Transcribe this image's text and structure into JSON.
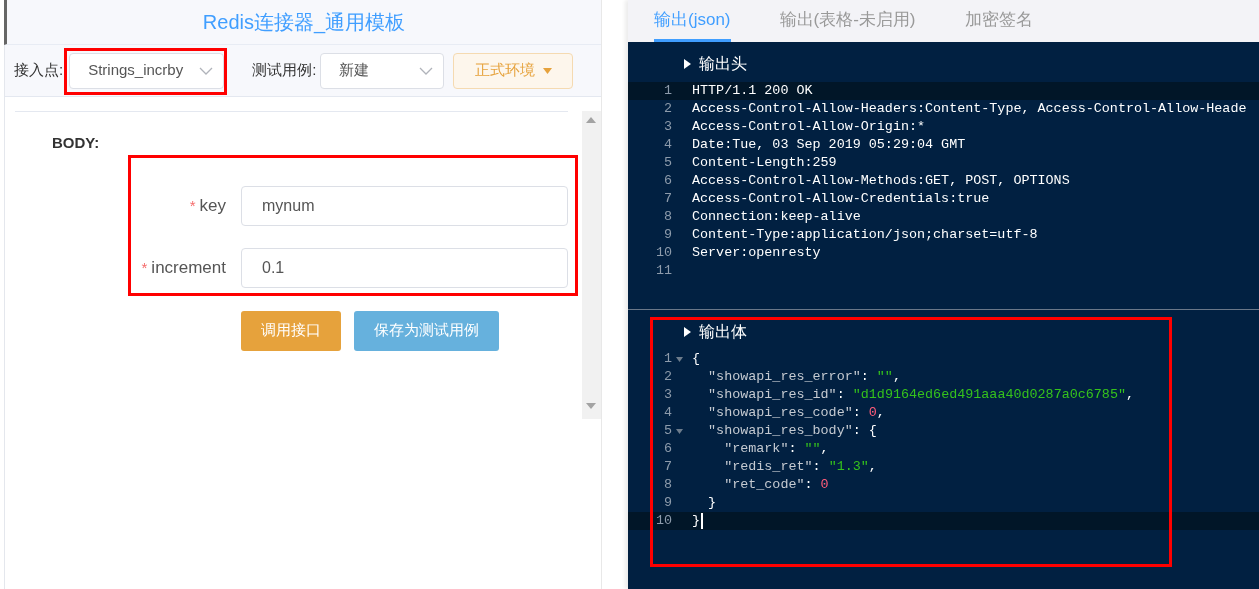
{
  "left_panel": {
    "title": "Redis连接器_通用模板",
    "toolbar": {
      "access_point": {
        "label": "接入点:",
        "value": "Strings_incrby",
        "highlighted": true
      },
      "test_case": {
        "label": "测试用例:",
        "value": "新建"
      },
      "environment_button": "正式环境"
    },
    "body_label": "BODY:",
    "form": {
      "highlighted": true,
      "fields": [
        {
          "required_mark": "*",
          "label": "key",
          "value": "mynum"
        },
        {
          "required_mark": "*",
          "label": "increment",
          "value": "0.1"
        }
      ]
    },
    "buttons": [
      {
        "kind": "primary",
        "label": "调用接口"
      },
      {
        "kind": "secondary",
        "label": "保存为测试用例"
      }
    ]
  },
  "right_panel": {
    "tabs": [
      {
        "label": "输出(json)",
        "selected": true
      },
      {
        "label": "输出(表格-未启用)",
        "selected": false
      },
      {
        "label": "加密签名",
        "selected": false
      }
    ],
    "header_section": {
      "title": "输出头",
      "lines": [
        {
          "number": "1",
          "active": true,
          "text": "HTTP/1.1 200 OK"
        },
        {
          "number": "2",
          "active": false,
          "text": "Access-Control-Allow-Headers:Content-Type, Access-Control-Allow-Heade"
        },
        {
          "number": "3",
          "active": false,
          "text": "Access-Control-Allow-Origin:*"
        },
        {
          "number": "4",
          "active": false,
          "text": "Date:Tue, 03 Sep 2019 05:29:04 GMT"
        },
        {
          "number": "5",
          "active": false,
          "text": "Content-Length:259"
        },
        {
          "number": "6",
          "active": false,
          "text": "Access-Control-Allow-Methods:GET, POST, OPTIONS"
        },
        {
          "number": "7",
          "active": false,
          "text": "Access-Control-Allow-Credentials:true"
        },
        {
          "number": "8",
          "active": false,
          "text": "Connection:keep-alive"
        },
        {
          "number": "9",
          "active": false,
          "text": "Content-Type:application/json;charset=utf-8"
        },
        {
          "number": "10",
          "active": false,
          "text": "Server:openresty"
        },
        {
          "number": "11",
          "active": false
        }
      ]
    },
    "body_section": {
      "title": "输出体",
      "highlighted": true,
      "lines": [
        {
          "number": "1",
          "active": false,
          "foldable": true,
          "tokens": [
            {
              "kind": "plain",
              "text": "{"
            }
          ]
        },
        {
          "number": "2",
          "active": false,
          "tokens": [
            {
              "kind": "key",
              "text": "  \"showapi_res_error\""
            },
            {
              "kind": "plain",
              "text": ": "
            },
            {
              "kind": "string",
              "text": "\"\""
            },
            {
              "kind": "plain",
              "text": ","
            }
          ]
        },
        {
          "number": "3",
          "active": false,
          "tokens": [
            {
              "kind": "key",
              "text": "  \"showapi_res_id\""
            },
            {
              "kind": "plain",
              "text": ": "
            },
            {
              "kind": "string",
              "text": "\"d1d9164ed6ed491aaa40d0287a0c6785\""
            },
            {
              "kind": "plain",
              "text": ","
            }
          ]
        },
        {
          "number": "4",
          "active": false,
          "tokens": [
            {
              "kind": "key",
              "text": "  \"showapi_res_code\""
            },
            {
              "kind": "plain",
              "text": ": "
            },
            {
              "kind": "number",
              "text": "0"
            },
            {
              "kind": "plain",
              "text": ","
            }
          ]
        },
        {
          "number": "5",
          "active": false,
          "foldable": true,
          "tokens": [
            {
              "kind": "key",
              "text": "  \"showapi_res_body\""
            },
            {
              "kind": "plain",
              "text": ": {"
            }
          ]
        },
        {
          "number": "6",
          "active": false,
          "tokens": [
            {
              "kind": "key",
              "text": "    \"remark\""
            },
            {
              "kind": "plain",
              "text": ": "
            },
            {
              "kind": "string",
              "text": "\"\""
            },
            {
              "kind": "plain",
              "text": ","
            }
          ]
        },
        {
          "number": "7",
          "active": false,
          "tokens": [
            {
              "kind": "key",
              "text": "    \"redis_ret\""
            },
            {
              "kind": "plain",
              "text": ": "
            },
            {
              "kind": "string",
              "text": "\"1.3\""
            },
            {
              "kind": "plain",
              "text": ","
            }
          ]
        },
        {
          "number": "8",
          "active": false,
          "tokens": [
            {
              "kind": "key",
              "text": "    \"ret_code\""
            },
            {
              "kind": "plain",
              "text": ": "
            },
            {
              "kind": "number",
              "text": "0"
            }
          ]
        },
        {
          "number": "9",
          "active": false,
          "tokens": [
            {
              "kind": "plain",
              "text": "  }"
            }
          ]
        },
        {
          "number": "10",
          "active": true,
          "cursor": true,
          "tokens": [
            {
              "kind": "plain",
              "text": "}"
            }
          ]
        }
      ]
    }
  }
}
